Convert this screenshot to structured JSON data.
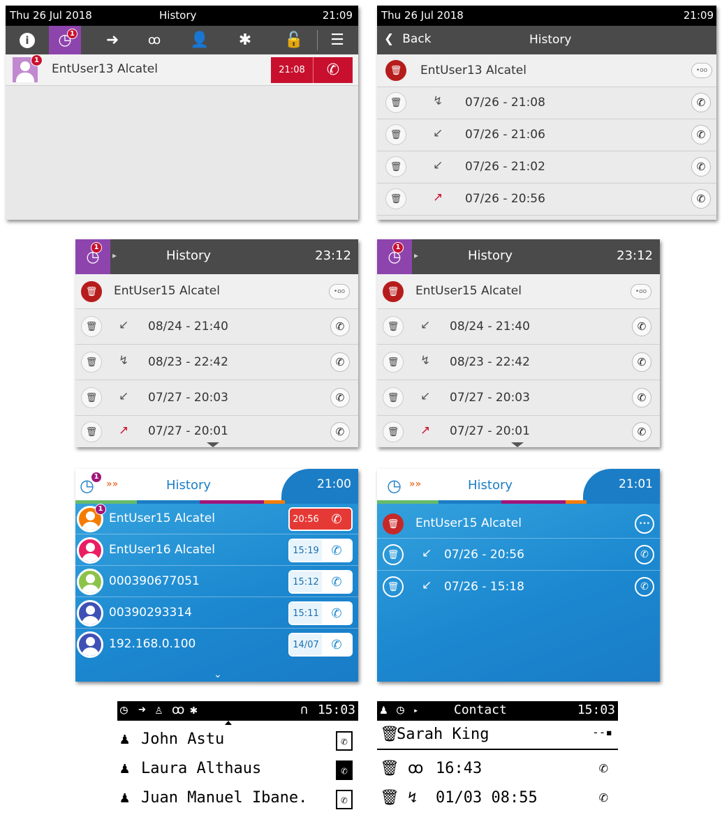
{
  "p1": {
    "date": "Thu 26 Jul 2018",
    "title": "History",
    "time": "21:09",
    "badge": "1",
    "entry": {
      "name": "EntUser13 Alcatel",
      "time": "21:08",
      "badge": "1"
    }
  },
  "p2": {
    "date": "Thu 26 Jul 2018",
    "time": "21:09",
    "back": "Back",
    "title": "History",
    "contact": "EntUser13 Alcatel",
    "more": "•oo",
    "calls": [
      {
        "datetime": "07/26 - 21:08"
      },
      {
        "datetime": "07/26 - 21:06"
      },
      {
        "datetime": "07/26 - 21:02"
      },
      {
        "datetime": "07/26 - 20:56"
      }
    ]
  },
  "p3": {
    "title": "History",
    "time": "23:12",
    "badge": "1",
    "contact": "EntUser15 Alcatel",
    "more": "•oo",
    "calls": [
      {
        "datetime": "08/24 - 21:40"
      },
      {
        "datetime": "08/23 - 22:42"
      },
      {
        "datetime": "07/27 - 20:03"
      },
      {
        "datetime": "07/27 - 20:01"
      }
    ]
  },
  "p4": {
    "title": "History",
    "time": "23:12",
    "badge": "1",
    "contact": "EntUser15 Alcatel",
    "more": "•oo",
    "calls": [
      {
        "datetime": "08/24 - 21:40"
      },
      {
        "datetime": "08/23 - 22:42"
      },
      {
        "datetime": "07/27 - 20:03"
      },
      {
        "datetime": "07/27 - 20:01"
      }
    ]
  },
  "p5": {
    "title": "History",
    "time": "21:00",
    "badge": "1",
    "chevrons": "»»",
    "entries": [
      {
        "name": "EntUser15 Alcatel",
        "time": "20:56",
        "badge": "1"
      },
      {
        "name": "EntUser16 Alcatel",
        "time": "15:19"
      },
      {
        "name": "000390677051",
        "time": "15:12"
      },
      {
        "name": "00390293314",
        "time": "15:11"
      },
      {
        "name": "192.168.0.100",
        "time": "14/07"
      }
    ]
  },
  "p6": {
    "title": "History",
    "time": "21:01",
    "chevrons": "»»",
    "contact": "EntUser15 Alcatel",
    "calls": [
      {
        "datetime": "07/26 - 20:56"
      },
      {
        "datetime": "07/26 - 15:18"
      }
    ]
  },
  "p7": {
    "time": "15:03",
    "contacts": [
      "John Astu",
      "Laura Althaus",
      "Juan Manuel Ibane."
    ]
  },
  "p8": {
    "title": "Contact",
    "time": "15:03",
    "contact": "Sarah King",
    "calls": [
      "16:43",
      "01/03 08:55"
    ]
  }
}
